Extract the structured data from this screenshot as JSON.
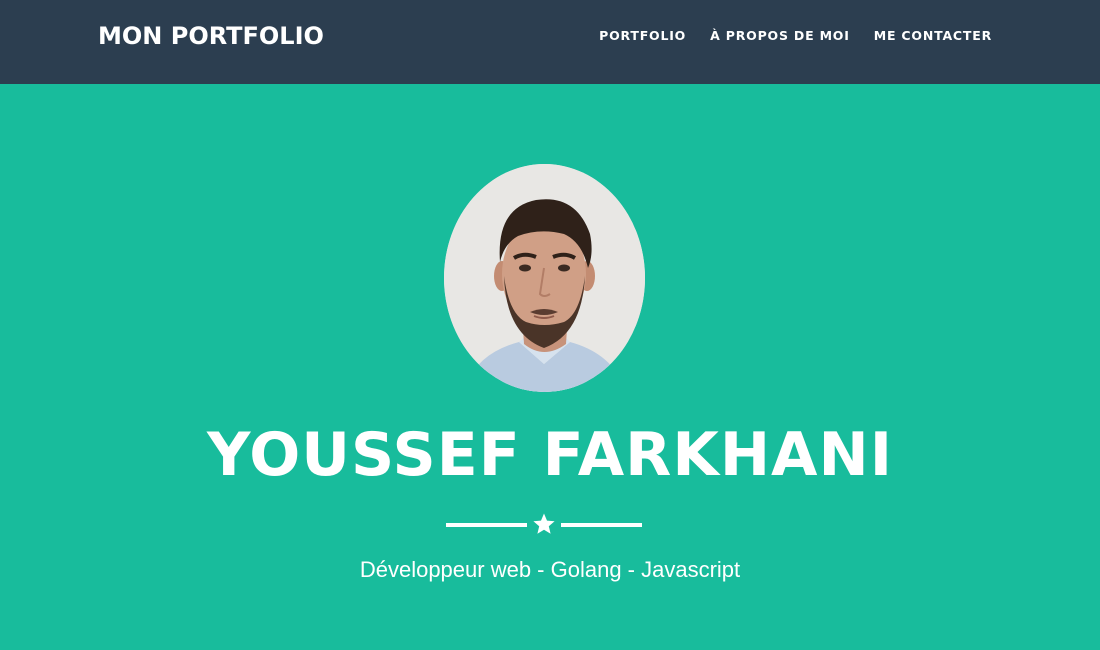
{
  "navbar": {
    "brand": "MON PORTFOLIO",
    "links": [
      "PORTFOLIO",
      "À PROPOS DE MOI",
      "ME CONTACTER"
    ]
  },
  "hero": {
    "name": "YOUSSEF FARKHANI",
    "divider_icon": "star-icon",
    "tagline": "Développeur web - Golang - Javascript"
  },
  "colors": {
    "navbar_bg": "#2c3e50",
    "hero_bg": "#18bc9c",
    "text": "#ffffff"
  }
}
